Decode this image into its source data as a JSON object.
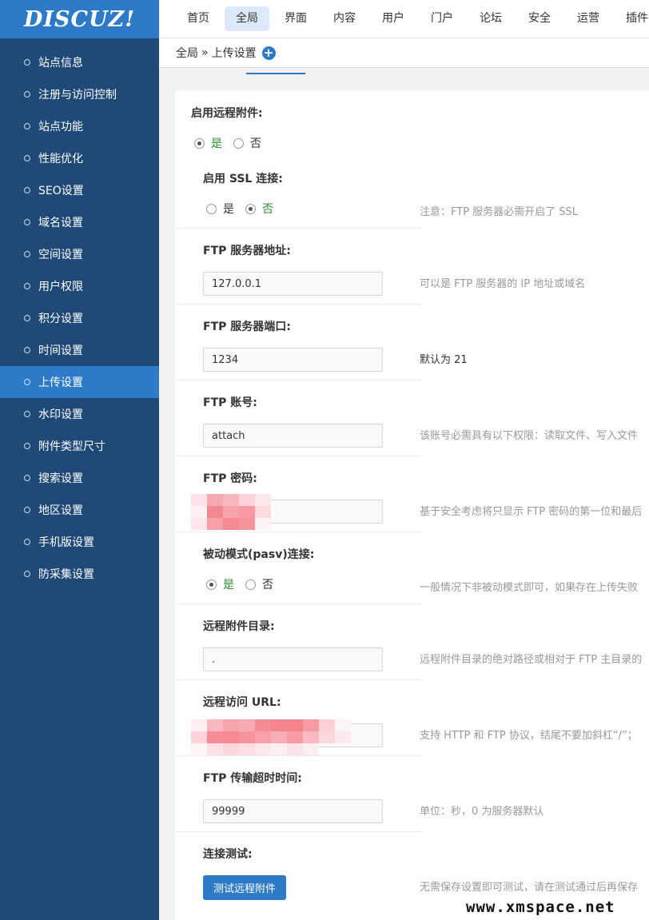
{
  "logo": {
    "text": "DISCUZ!"
  },
  "topnav": {
    "items": [
      "首页",
      "全局",
      "界面",
      "内容",
      "用户",
      "门户",
      "论坛",
      "安全",
      "运营",
      "插件"
    ],
    "active_index": 1
  },
  "breadcrumb": {
    "root": "全局",
    "separator": "»",
    "current": "上传设置"
  },
  "sidebar": {
    "items": [
      "站点信息",
      "注册与访问控制",
      "站点功能",
      "性能优化",
      "SEO设置",
      "域名设置",
      "空间设置",
      "用户权限",
      "积分设置",
      "时间设置",
      "上传设置",
      "水印设置",
      "附件类型尺寸",
      "搜索设置",
      "地区设置",
      "手机版设置",
      "防采集设置"
    ],
    "active_index": 10
  },
  "form": {
    "remote": {
      "label": "启用远程附件:",
      "yes": "是",
      "no": "否",
      "selected": "yes"
    },
    "ssl": {
      "label": "启用 SSL 连接:",
      "yes": "是",
      "no": "否",
      "selected": "no",
      "tip": "注意：FTP 服务器必需开启了 SSL"
    },
    "host": {
      "label": "FTP 服务器地址:",
      "value": "127.0.0.1",
      "tip": "可以是 FTP 服务器的 IP 地址或域名"
    },
    "port": {
      "label": "FTP 服务器端口:",
      "value": "1234",
      "tip": "默认为 21"
    },
    "account": {
      "label": "FTP 账号:",
      "value": "attach",
      "tip": "该账号必需具有以下权限：读取文件、写入文件"
    },
    "password": {
      "label": "FTP 密码:",
      "value": "",
      "tip": "基于安全考虑将只显示 FTP 密码的第一位和最后"
    },
    "pasv": {
      "label": "被动模式(pasv)连接:",
      "yes": "是",
      "no": "否",
      "selected": "yes",
      "tip": "一般情况下非被动模式即可，如果存在上传失败"
    },
    "dir": {
      "label": "远程附件目录:",
      "value": ".",
      "tip": "远程附件目录的绝对路径或相对于 FTP 主目录的"
    },
    "url": {
      "label": "远程访问 URL:",
      "value": "",
      "tip": "支持 HTTP 和 FTP 协议，结尾不要加斜杠“/”；"
    },
    "timeout": {
      "label": "FTP 传输超时时间:",
      "value": "99999",
      "tip": "单位：秒，0 为服务器默认"
    },
    "test": {
      "label": "连接测试:",
      "button": "测试远程附件",
      "tip": "无需保存设置即可测试，请在测试通过后再保存"
    }
  },
  "colors": {
    "sidebar_bg": "#1f4a78",
    "accent": "#2d7bc8",
    "active_nav": "#dbe9f8",
    "selected_radio_text": "#2e8b2e"
  },
  "watermark": "www.xmspace.net"
}
